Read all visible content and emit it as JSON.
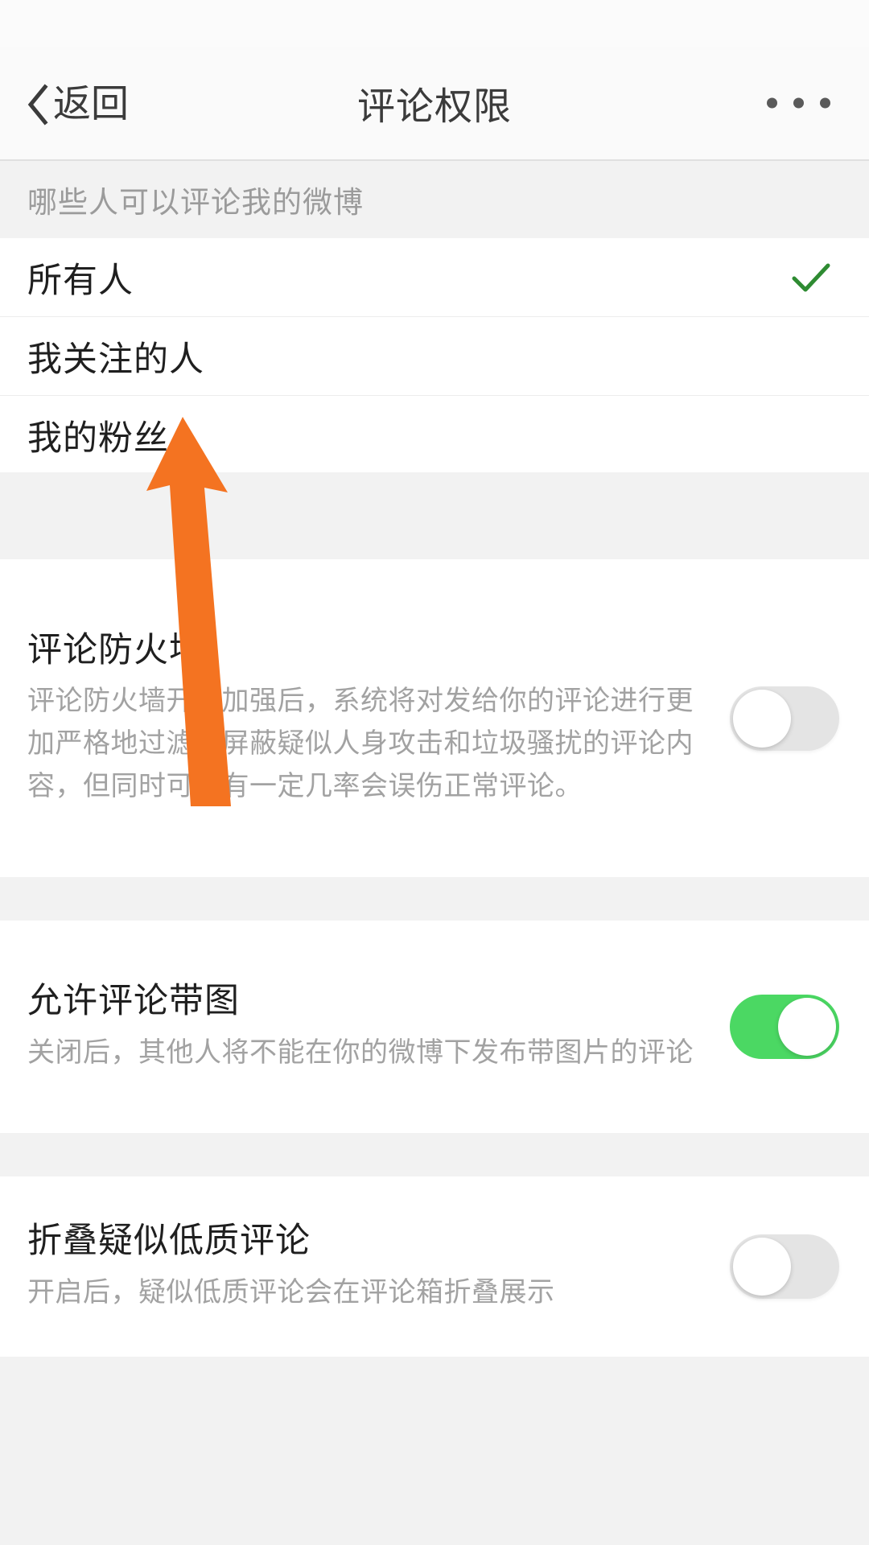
{
  "navbar": {
    "back_label": "返回",
    "title": "评论权限",
    "more_icon": "ellipsis-icon"
  },
  "section_comment_scope": {
    "header": "哪些人可以评论我的微博",
    "options": [
      {
        "label": "所有人",
        "selected": true
      },
      {
        "label": "我关注的人",
        "selected": false
      },
      {
        "label": "我的粉丝",
        "selected": false
      }
    ]
  },
  "settings": [
    {
      "title": "评论防火墙",
      "desc": "评论防火墙开启加强后，系统将对发给你的评论进行更加严格地过滤，屏蔽疑似人身攻击和垃圾骚扰的评论内容，但同时可能有一定几率会误伤正常评论。",
      "switch_state": "off"
    },
    {
      "title": "允许评论带图",
      "desc": "关闭后，其他人将不能在你的微博下发布带图片的评论",
      "switch_state": "on"
    },
    {
      "title": "折叠疑似低质评论",
      "desc": "开启后，疑似低质评论会在评论箱折叠展示",
      "switch_state": "off"
    }
  ],
  "annotation": {
    "type": "arrow",
    "color": "#f47321",
    "points_to": "我关注的人"
  },
  "colors": {
    "accent_green": "#4bd863",
    "check_green": "#2e8b32",
    "page_bg": "#f2f2f2",
    "card_bg": "#ffffff",
    "title_text": "#1f1f1f",
    "muted_text": "#a2a2a2",
    "annotation_orange": "#f47321"
  }
}
